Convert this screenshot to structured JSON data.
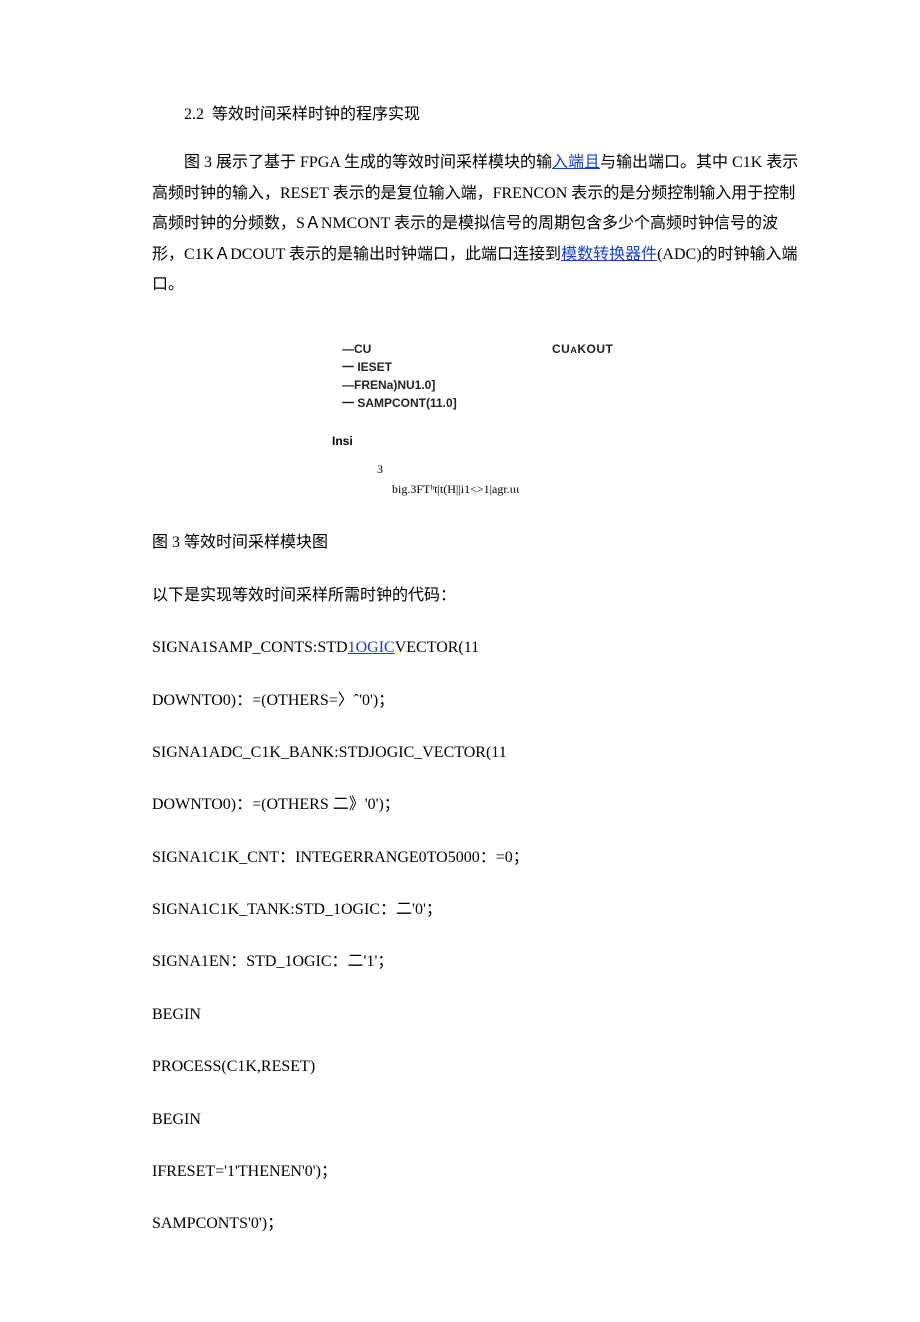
{
  "section": {
    "number": "2.2",
    "title": "等效时间采样时钟的程序实现"
  },
  "paragraph": {
    "part1": "图 3 展示了基于 FPGA 生成的等效时间采样模块的输",
    "link1": "入端且",
    "part2": "与输出端口。其中 C1K 表示高频时钟的输入，RESET 表示的是复位输入端，FRENCON 表示的是分频控制输入用于控制高频时钟的分频数，SＡNMCONT 表示的是模拟信号的周期包含多少个高频时钟信号的波形，C1KＡDCOUT 表示的是输出时钟端口，此端口连接到",
    "link2": "模数转换器件",
    "part3": "(ADC)的时钟输入端口。"
  },
  "figure": {
    "signals_left": [
      "—CU",
      "一 IESET",
      "—FRENa)NU1.0]",
      "一 SAMPCONT(11.0]"
    ],
    "signal_right_pre": "CU",
    "signal_right_a": "A",
    "signal_right_post": "KOUT",
    "insi": "Insi",
    "sub1": "3",
    "sub2": "big.3FTʰt|t(H||i1<>1|agr.ιιι"
  },
  "caption": "图 3 等效时间采样模块图",
  "code_intro": "以下是实现等效时间采样所需时钟的代码：",
  "code": {
    "l1a": "SIGNA1SAMP_CONTS:STD",
    "l1link": "1OGIC",
    "l1b": "VECTOR(11",
    "l2": "DOWNTO0)：=(OTHERS=〉ˆ'0')；",
    "l3": "SIGNA1ADC_C1K_BANK:STDJOGIC_VECTOR(11",
    "l4": "DOWNTO0)：=(OTHERS 二》'0')；",
    "l5": "SIGNA1C1K_CNT：INTEGERRANGE0TO5000：=0；",
    "l6": "SIGNA1C1K_TANK:STD_1OGIC：二'0'；",
    "l7": "SIGNA1EN：STD_1OGIC：二'1'；",
    "l8": "BEGIN",
    "l9": "PROCESS(C1K,RESET)",
    "l10": "BEGIN",
    "l11": "IFRESET='1'THENEN'0')；",
    "l12": "SAMPCONTS'0')；"
  }
}
